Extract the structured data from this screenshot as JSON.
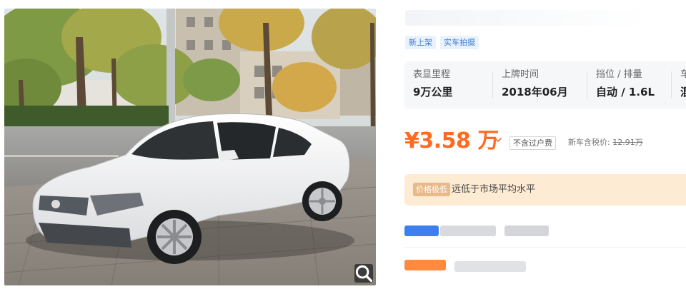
{
  "photo": {
    "alt": "白色大众轿车实拍图",
    "zoom_icon": "search-icon"
  },
  "tags": [
    "新上架",
    "实车拍摄"
  ],
  "specs": [
    {
      "label": "表显里程",
      "value": "9万公里"
    },
    {
      "label": "上牌时间",
      "value": "2018年06月"
    },
    {
      "label": "挡位 / 排量",
      "value": "自动 / 1.6L"
    },
    {
      "label": "车",
      "value": "混"
    }
  ],
  "price": {
    "amount": "¥3.58 万",
    "fee_note": "不含过户费",
    "new_price_label": "新车含税价:",
    "new_price_value": "12.91万"
  },
  "evaluation": {
    "badge": "价格极低",
    "text": "远低于市场平均水平"
  },
  "colors": {
    "price": "#ff6b22",
    "tag_text": "#3a7bd5",
    "tag_bg": "#eaf2fd",
    "spec_bg": "#f6f7f9",
    "eval_bg": "#fdebd3"
  }
}
